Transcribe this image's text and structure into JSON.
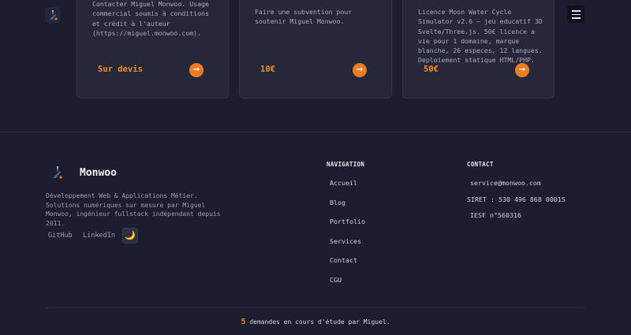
{
  "cards": [
    {
      "text": "Contacter Miguel Monwoo. Usage\ncommercial soumis à conditions\net crédit à l'auteur\n(https://miguel.monwoo.com).",
      "price": "Sur devis"
    },
    {
      "text": "Faire une subvention pour\nsoutenir Miguel Monwoo.",
      "price": "10€"
    },
    {
      "text": "Licence Moon Water Cycle\nSimulator v2.6 — jeu educatif 3D\nSvelte/Three.js. 50€ licence a\nvie pour 1 domaine, marque\nblanche, 26 especes, 12 langues.\nDeploiement statique HTML/PHP.",
      "price": "50€"
    }
  ],
  "card_arrow": "→",
  "brand": {
    "name": "Monwoo",
    "description": "Développement Web & Applications Métier. Solutions numériques sur mesure par Miguel Monwoo, ingénieur fullstack indépendant depuis 2011."
  },
  "social": {
    "github": "GitHub",
    "linkedin": "LinkedIn",
    "theme_icon": "🌙"
  },
  "navigation": {
    "title": "NAVIGATION",
    "links": [
      "Accueil",
      "Blog",
      "Portfolio",
      "Services",
      "Contact",
      "CGU"
    ]
  },
  "contact": {
    "title": "CONTACT",
    "email": "service@monwoo.com",
    "siret": "SIRET : 530 496 868 00015",
    "iesf": "IESF n°560316"
  },
  "status": {
    "count": "5",
    "text": " demandes en cours d'étude par Miguel."
  },
  "colors": {
    "accent": "#f08a24",
    "background": "#1c1d2e",
    "card": "#262839"
  }
}
